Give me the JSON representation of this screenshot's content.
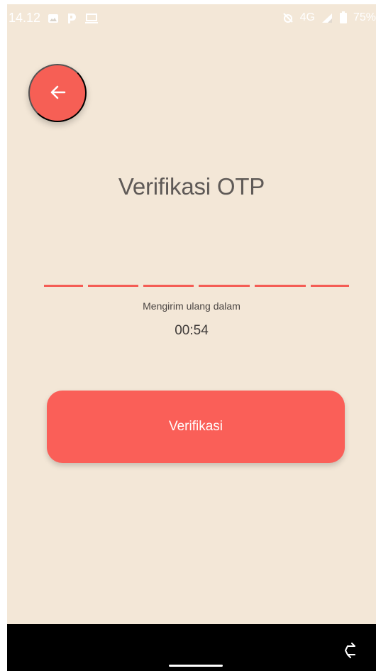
{
  "status_bar": {
    "time": "14.12",
    "network": "4G",
    "battery": "75%",
    "icons": [
      "image-icon",
      "parking-icon",
      "laptop-icon",
      "alarm-off-icon",
      "signal-icon",
      "battery-icon"
    ]
  },
  "header": {
    "back_icon": "arrow-left-icon",
    "title": "Verifikasi OTP"
  },
  "otp": {
    "digits": [
      "",
      "",
      "",
      "",
      "",
      ""
    ],
    "resend_label": "Mengirim ulang dalam",
    "countdown": "00:54"
  },
  "actions": {
    "verify_label": "Verifikasi"
  },
  "nav_bar": {
    "rotate_icon": "rotate-icon"
  },
  "colors": {
    "background": "#f3e7d7",
    "accent": "#fa5f58",
    "title_text": "#5f5a57"
  }
}
